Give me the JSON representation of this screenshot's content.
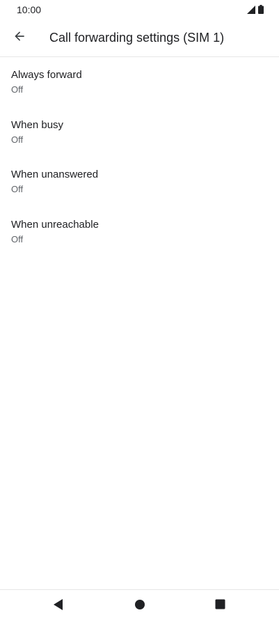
{
  "status_bar": {
    "time": "10:00",
    "icons": [
      "signal-icon",
      "battery-icon"
    ]
  },
  "app_bar": {
    "title": "Call forwarding settings (SIM 1)",
    "back_icon": "arrow-back-icon"
  },
  "settings": [
    {
      "title": "Always forward",
      "summary": "Off"
    },
    {
      "title": "When busy",
      "summary": "Off"
    },
    {
      "title": "When unanswered",
      "summary": "Off"
    },
    {
      "title": "When unreachable",
      "summary": "Off"
    }
  ],
  "nav_bar": {
    "buttons": [
      "nav-back-icon",
      "nav-home-icon",
      "nav-recents-icon"
    ]
  },
  "colors": {
    "text_primary": "#202124",
    "text_secondary": "#5f6368",
    "divider": "#e6e6e6",
    "icon": "#3c4043"
  }
}
